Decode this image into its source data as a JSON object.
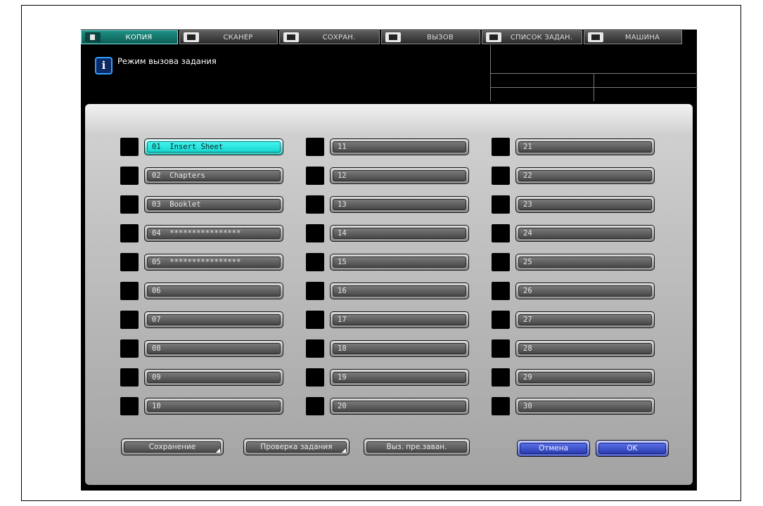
{
  "tabs": [
    {
      "label": "КОПИЯ",
      "icon": "copy-icon",
      "active": true
    },
    {
      "label": "СКАНЕР",
      "icon": "scanner-icon",
      "active": false
    },
    {
      "label": "СОХРАН.",
      "icon": "store-icon",
      "active": false
    },
    {
      "label": "ВЫЗОВ",
      "icon": "recall-icon",
      "active": false
    },
    {
      "label": "СПИСОК ЗАДАН.",
      "icon": "job-list-icon",
      "active": false
    },
    {
      "label": "МАШИНА",
      "icon": "machine-icon",
      "active": false
    }
  ],
  "message": {
    "icon": "info-icon",
    "text": "Режим вызова задания"
  },
  "jobs": {
    "col1": [
      "01  Insert Sheet",
      "02  Chapters",
      "03  Booklet",
      "04  ****************",
      "05  ****************",
      "06",
      "07",
      "08",
      "09",
      "10"
    ],
    "col2": [
      "11",
      "12",
      "13",
      "14",
      "15",
      "16",
      "17",
      "18",
      "19",
      "20"
    ],
    "col3": [
      "21",
      "22",
      "23",
      "24",
      "25",
      "26",
      "27",
      "28",
      "29",
      "30"
    ],
    "selected": "01"
  },
  "buttons": {
    "save": "Сохранение",
    "check_job": "Проверка задания",
    "recall_prev": "Выз. пре.заван.",
    "cancel": "Отмена",
    "ok": "OK"
  },
  "colors": {
    "selected": "#1ee6dc",
    "tab_active": "#138074",
    "ok_blue": "#3a4fd0"
  }
}
